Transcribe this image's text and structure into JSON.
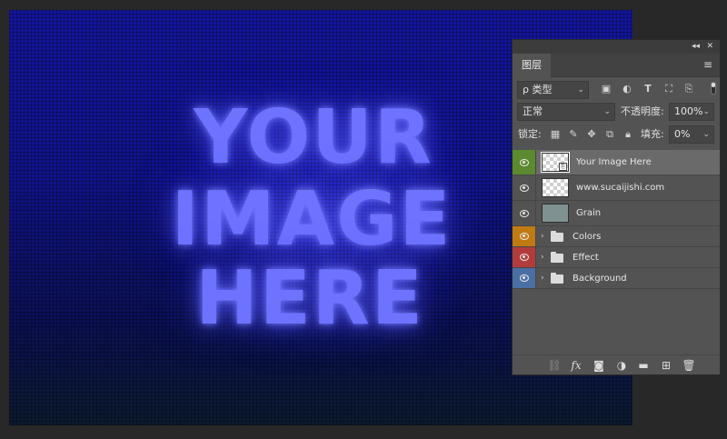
{
  "canvas": {
    "headline_line1": "YOUR",
    "headline_line2": "IMAGE",
    "headline_line3": "HERE"
  },
  "panel": {
    "collapse_icon": "◂◂",
    "close_icon": "✕",
    "tab_label": "图层",
    "menu_icon": "≡",
    "filter": {
      "value": "ρ 类型",
      "icons": [
        "image-filter-icon",
        "adjustment-filter-icon",
        "type-filter-icon",
        "shape-filter-icon",
        "smart-object-filter-icon"
      ]
    },
    "blend_mode": "正常",
    "opacity_label": "不透明度:",
    "opacity_value": "100%",
    "lock_label": "锁定:",
    "fill_label": "填充:",
    "fill_value": "0%",
    "layers": [
      {
        "name": "Your Image Here",
        "type": "smart-object",
        "eye_color": "#5b8a2f",
        "selected": true
      },
      {
        "name": "www.sucaijishi.com",
        "type": "layer",
        "eye_color": "#535353",
        "selected": false
      },
      {
        "name": "Grain",
        "type": "layer",
        "eye_color": "#535353",
        "selected": false
      },
      {
        "name": "Colors",
        "type": "group",
        "eye_color": "#c07a13",
        "selected": false
      },
      {
        "name": "Effect",
        "type": "group",
        "eye_color": "#b23c3c",
        "selected": false
      },
      {
        "name": "Background",
        "type": "group",
        "eye_color": "#4a6fa5",
        "selected": false
      }
    ],
    "footer_icons": [
      "link-icon",
      "fx-icon",
      "mask-icon",
      "adjustment-icon",
      "folder-icon",
      "new-layer-icon",
      "trash-icon"
    ]
  }
}
